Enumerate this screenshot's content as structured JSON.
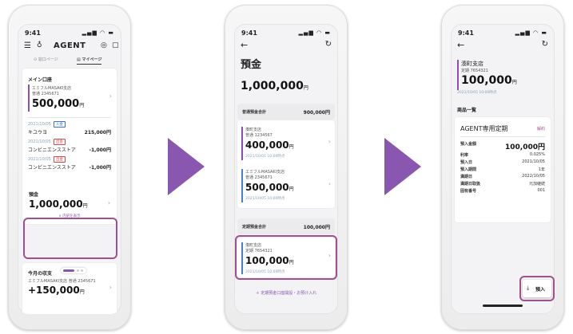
{
  "colors": {
    "accent_purple": "#8a57b0",
    "highlight": "#a24f8d",
    "bar_purple": "#8b4fb6",
    "bar_blue": "#4a7fd0",
    "income": "#3a6fd8",
    "expense": "#d64545"
  },
  "screen1": {
    "time": "9:41",
    "app_title": "AGENT",
    "tab_top": "⊙ 窓口ページ",
    "tab_mypage": "▤ マイページ",
    "main_account": {
      "heading": "メイン口座",
      "branch": "エミフルMASAKI支店",
      "number": "普通 2345671",
      "balance": "500,000",
      "yen": "円"
    },
    "transactions": [
      {
        "date": "2021/10/05",
        "tag": "入金",
        "desc": "キユウヨ",
        "amount": "215,000円"
      },
      {
        "date": "2021/10/05",
        "tag": "出金",
        "desc": "コンビニエンスストア",
        "amount": "-1,000円"
      },
      {
        "date": "2021/10/05",
        "tag": "出金",
        "desc": "コンビニエンスストア",
        "amount": "-1,000円"
      }
    ],
    "deposit": {
      "heading": "預金",
      "total": "1,000,000",
      "yen": "円",
      "show_detail": "∨ 内訳を表示"
    },
    "income_expense": {
      "heading": "今月の収支",
      "account": "エミフルMASAKI支店 普通 2345671",
      "amount": "+150,000",
      "yen": "円"
    }
  },
  "screen2": {
    "time": "9:41",
    "title": "預金",
    "total": "1,000,000",
    "yen": "円",
    "ordinary_label": "普通預金合計",
    "ordinary_total": "900,000円",
    "ordinary_accounts": [
      {
        "branch": "湊町支店",
        "number": "普通 1234567",
        "balance": "400,000",
        "ts": "2021/10/05 10:00時点"
      },
      {
        "branch": "エミフルMASAKI支店",
        "number": "普通 2345671",
        "balance": "500,000",
        "ts": "2021/10/05 10:00時点"
      }
    ],
    "time_label": "定期預金合計",
    "time_total": "100,000円",
    "time_account": {
      "branch": "湊町支店",
      "number": "定期 7654321",
      "balance": "100,000",
      "ts": "2021/10/05 10:00時点"
    },
    "open_link": "＋ 定期預金口座開設・お預け入れ"
  },
  "screen3": {
    "time": "9:41",
    "branch": "湊町支店",
    "number": "定期 7654321",
    "balance": "100,000",
    "yen": "円",
    "ts": "2021/10/05 10:00時点",
    "product_heading": "商品一覧",
    "product_name": "AGENT専用定期",
    "cancel": "解約",
    "details": [
      {
        "k": "預入金額",
        "v": "100,000円"
      },
      {
        "k": "利率",
        "v": "0.025%"
      },
      {
        "k": "預入日",
        "v": "2021/10/05"
      },
      {
        "k": "預入期間",
        "v": "1年"
      },
      {
        "k": "満期日",
        "v": "2022/10/05"
      },
      {
        "k": "満期日取扱",
        "v": "元加継続"
      },
      {
        "k": "固有番号",
        "v": "001"
      }
    ],
    "deposit_button": "預入"
  }
}
